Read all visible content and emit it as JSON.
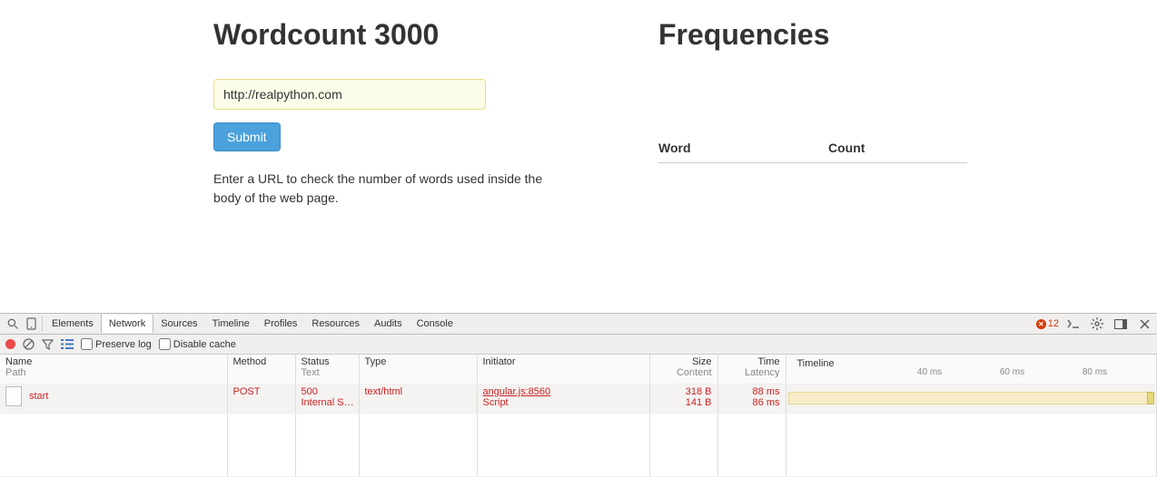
{
  "app": {
    "title": "Wordcount 3000",
    "url_value": "http://realpython.com",
    "submit_label": "Submit",
    "help_text": "Enter a URL to check the number of words used inside the body of the web page."
  },
  "freq": {
    "title": "Frequencies",
    "col_word": "Word",
    "col_count": "Count"
  },
  "devtools": {
    "tabs": [
      "Elements",
      "Network",
      "Sources",
      "Timeline",
      "Profiles",
      "Resources",
      "Audits",
      "Console"
    ],
    "active_tab": "Network",
    "error_count": "12",
    "preserve_log_label": "Preserve log",
    "disable_cache_label": "Disable cache",
    "columns": {
      "name": "Name",
      "name_sub": "Path",
      "method": "Method",
      "status": "Status",
      "status_sub": "Text",
      "type": "Type",
      "initiator": "Initiator",
      "size": "Size",
      "size_sub": "Content",
      "time": "Time",
      "time_sub": "Latency",
      "timeline": "Timeline"
    },
    "ticks": {
      "t40": "40 ms",
      "t60": "60 ms",
      "t80": "80 ms"
    },
    "row": {
      "name": "start",
      "method": "POST",
      "status": "500",
      "status_text": "Internal S…",
      "type": "text/html",
      "initiator": "angular.js:8560",
      "initiator_sub": "Script",
      "size": "318 B",
      "content": "141 B",
      "time": "88 ms",
      "latency": "86 ms"
    }
  }
}
